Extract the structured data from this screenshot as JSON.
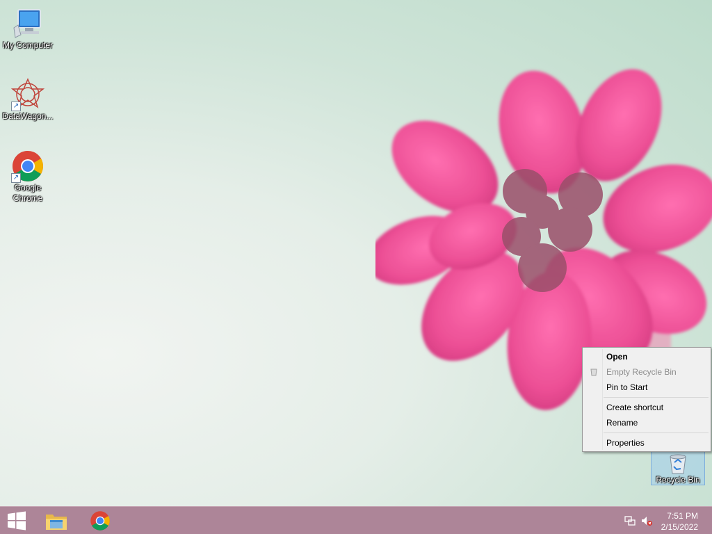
{
  "desktop": {
    "icons": [
      {
        "label": "My Computer",
        "icon": "computer-icon"
      },
      {
        "label": "DataWagon...",
        "icon": "datawagon-icon"
      },
      {
        "label": "Google Chrome",
        "icon": "chrome-icon"
      },
      {
        "label": "Recycle Bin",
        "icon": "recycle-bin-icon"
      }
    ]
  },
  "context_menu": {
    "items": [
      {
        "label": "Open",
        "bold": true
      },
      {
        "label": "Empty Recycle Bin",
        "disabled": true
      },
      {
        "label": "Pin to Start"
      },
      {
        "label": "Create shortcut"
      },
      {
        "label": "Rename"
      },
      {
        "label": "Properties"
      }
    ]
  },
  "taskbar": {
    "pinned": [
      "start-icon",
      "file-explorer-icon",
      "chrome-icon"
    ],
    "tray": [
      "network-icon",
      "volume-muted-icon"
    ],
    "time": "7:51 PM",
    "date": "2/15/2022"
  }
}
